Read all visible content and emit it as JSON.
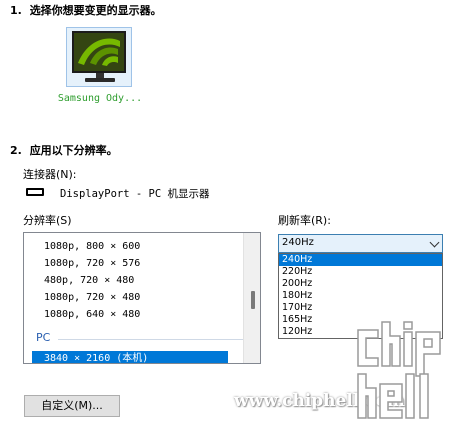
{
  "step1": {
    "number": "1.",
    "title": "选择你想要变更的显示器。"
  },
  "monitor": {
    "name": "Samsung Ody..."
  },
  "step2": {
    "number": "2.",
    "title": "应用以下分辨率。"
  },
  "connector": {
    "label": "连接器(N):",
    "value": "DisplayPort - PC 机显示器"
  },
  "resolution": {
    "label": "分辨率(S)",
    "items": [
      "1080p, 800 × 600",
      "1080p, 720 × 576",
      "480p, 720 × 480",
      "1080p, 720 × 480",
      "1080p, 640 × 480"
    ],
    "group": "PC",
    "selected": "3840 × 2160 (本机)"
  },
  "refresh": {
    "label": "刷新率(R):",
    "value": "240Hz",
    "options": [
      "240Hz",
      "220Hz",
      "200Hz",
      "180Hz",
      "170Hz",
      "165Hz",
      "120Hz"
    ],
    "selected_index": 0
  },
  "custom_button": {
    "label": "自定义(M)..."
  },
  "watermark": {
    "url": "www.chiphell.com",
    "logo": "chip hell"
  },
  "colors": {
    "accent": "#0078d7",
    "monitor_label": "#2f9e2f",
    "group_label": "#2a5fb0"
  }
}
